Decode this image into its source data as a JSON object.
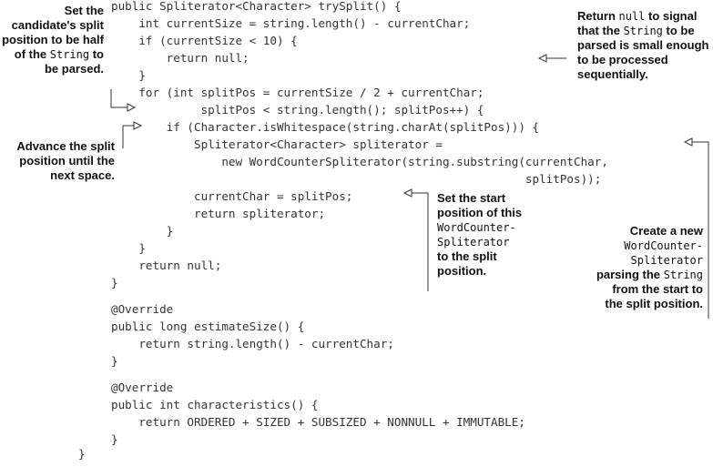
{
  "code": [
    "public Spliterator<Character> trySplit() {",
    "    int currentSize = string.length() - currentChar;",
    "    if (currentSize < 10) {",
    "        return null;",
    "    }",
    "    for (int splitPos = currentSize / 2 + currentChar;",
    "             splitPos < string.length(); splitPos++) {",
    "        if (Character.isWhitespace(string.charAt(splitPos))) {",
    "            Spliterator<Character> spliterator =",
    "                new WordCounterSpliterator(string.substring(currentChar,",
    "                                                            splitPos));",
    "            currentChar = splitPos;",
    "            return spliterator;",
    "        }",
    "    }",
    "    return null;",
    "}",
    "@Override",
    "public long estimateSize() {",
    "    return string.length() - currentChar;",
    "}",
    "@Override",
    "public int characteristics() {",
    "    return ORDERED + SIZED + SUBSIZED + NONNULL + IMMUTABLE;",
    "}",
    "}"
  ],
  "annotations": {
    "split_half": {
      "l1": "Set the",
      "l2": "candidate's split",
      "l3": "position to be half",
      "l4_pre": "of the ",
      "l4_code": "String",
      "l4_post": " to",
      "l5": "be parsed."
    },
    "advance": {
      "l1": "Advance the split",
      "l2": "position until the",
      "l3": "next space."
    },
    "return_null": {
      "l1_pre": "Return ",
      "l1_code": "null",
      "l1_post": " to signal",
      "l2_pre": "that the ",
      "l2_code": "String",
      "l2_post": " to be",
      "l3": "parsed is small enough",
      "l4": "to be processed",
      "l5": "sequentially."
    },
    "set_start": {
      "l1": "Set the start",
      "l2": "position of this",
      "l3_code": "WordCounter-",
      "l4_code": "Spliterator",
      "l5": "to the split",
      "l6": "position."
    },
    "create_new": {
      "l1": "Create a new",
      "l2_code": "WordCounter-",
      "l3_code": "Spliterator",
      "l4_pre": "parsing the ",
      "l4_code": "String",
      "l5": "from the start to",
      "l6": "the split position."
    }
  }
}
